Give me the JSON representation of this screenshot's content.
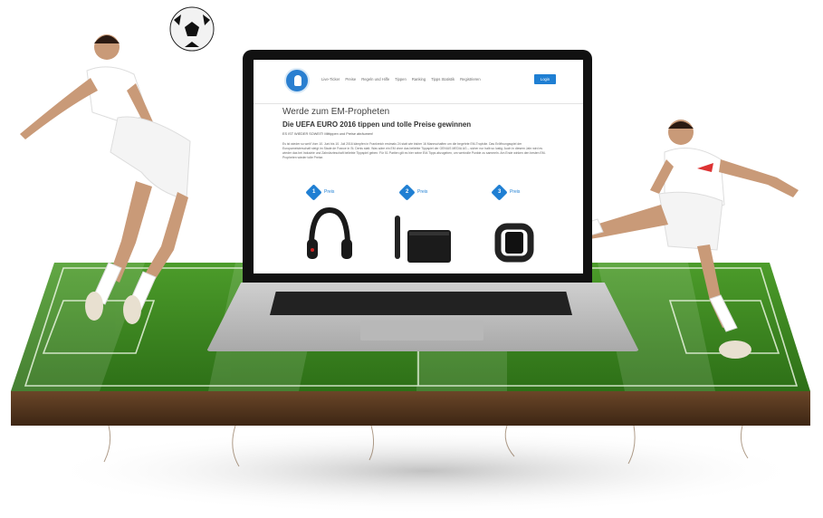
{
  "site": {
    "nav": {
      "logo_icon": "football-player-logo-icon",
      "items": [
        {
          "label": "Live-Ticker"
        },
        {
          "label": "Preise"
        },
        {
          "label": "Regeln und Hilfe"
        },
        {
          "label": "Tippen"
        },
        {
          "label": "Ranking"
        },
        {
          "label": "Tipps Statistik"
        },
        {
          "label": "Registrieren"
        }
      ],
      "login_label": "Login"
    },
    "heading": "Werde zum EM-Propheten",
    "title": "Die UEFA EURO 2016 tippen und tolle Preise gewinnen",
    "tagline": "ES IST WIEDER SOWEIT! Mittippen und Preise abräumen!",
    "paragraph": "Es ist wieder so weit! Vom 10. Juni bis 10. Juli 2016 kämpfen in Frankreich erstmals 24 statt wie bisher 16 Mannschaften um die begehrte EM-Trophäe. Das Eröffnungsspiel der Europameisterschaft steigt im Stade de France in St. Denis statt. Was wäre ein EM ohne das beliebte Tippspiel der GENIUS MEDIA AG – sicher nur halb so lustig. Auch in diesem Jahr wird es wieder das bei Industrie und Zahnärzteschaft beliebte Tippspiel geben. Für 51 Partien gilt es hier seine EM-Tipps abzugeben, um wertvolle Punkte zu sammeln. Am Ende winken den besten EM-Propheten wieder tolle Preise.",
    "prizes": [
      {
        "number": "1",
        "label": "Preis",
        "item": "headphones"
      },
      {
        "number": "2",
        "label": "Preis",
        "item": "tv-box"
      },
      {
        "number": "3",
        "label": "Preis",
        "item": "fitness-tracker"
      }
    ],
    "accent_color": "#1f7fd3"
  },
  "colors": {
    "grass": "#3a8a1f",
    "soil": "#5a3a22",
    "laptop_body": "#c9c9c9",
    "jersey_white": "#ffffff"
  }
}
